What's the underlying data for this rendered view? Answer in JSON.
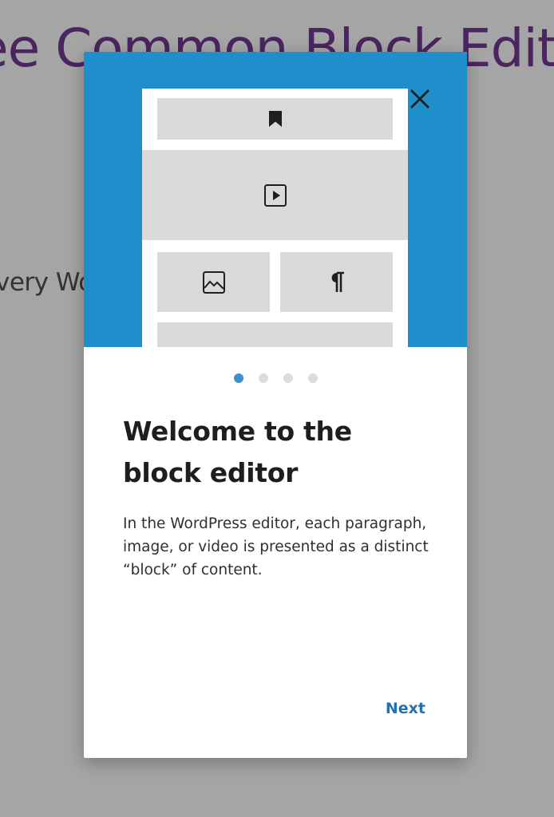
{
  "background": {
    "heading": "ee Common Block Edit",
    "text": "very Wo                              e things,"
  },
  "guide": {
    "close_icon": "close-icon",
    "illustration_icons": [
      "bookmark-icon",
      "video-icon",
      "image-icon",
      "paragraph-icon"
    ],
    "pages": 4,
    "current_page": 1,
    "title": "Welcome to the block editor",
    "body": "In the WordPress editor, each paragraph, image, or video is presented as a distinct “block” of content.",
    "next_label": "Next"
  },
  "colors": {
    "hero_bg": "#1f8fcb",
    "accent": "#2271b1",
    "dot_active": "#3f8fcb",
    "dot_inactive": "#dcdcde",
    "bg_heading": "#4a2560"
  }
}
